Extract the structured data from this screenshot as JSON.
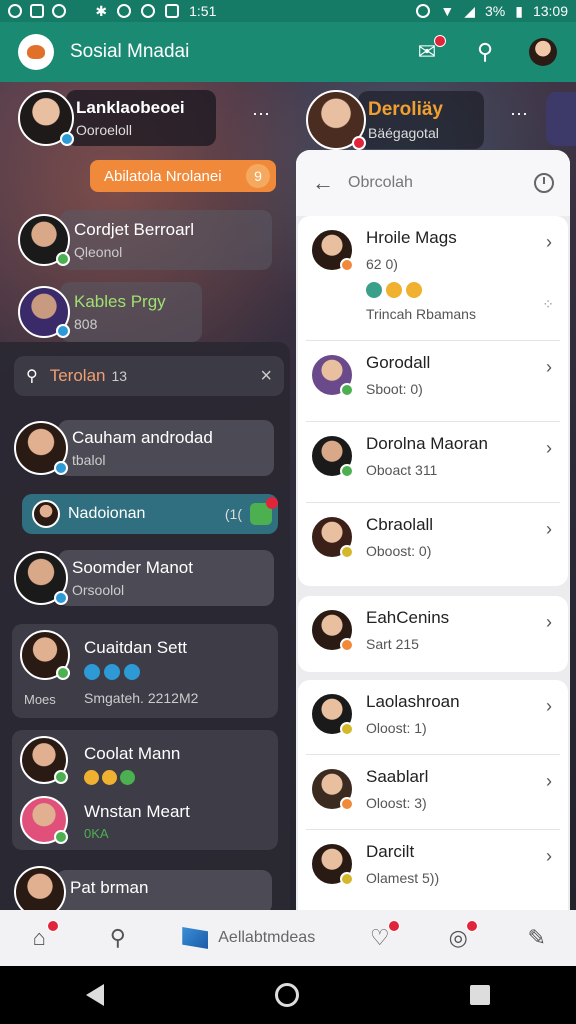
{
  "status_bar": {
    "battery": "3%",
    "time": "13:09",
    "left_text": "1:51"
  },
  "app_bar": {
    "title": "Sosial Mnadai"
  },
  "top_row": [
    {
      "name": "Lanklaobeoei",
      "sub": "Ooroeloll"
    },
    {
      "name": "Deroliäy",
      "sub": "Bäégagotal"
    }
  ],
  "orange_pill": {
    "label": "Abilatola Nrolanei",
    "icon_label": "9"
  },
  "left_cards": [
    {
      "name": "Cordjet Berroarl",
      "sub": "Qleonol"
    },
    {
      "name": "Kables Prgy",
      "sub": "808"
    }
  ],
  "search": {
    "query": "Terolan",
    "count": "13"
  },
  "list": [
    {
      "name": "Cauham androdad",
      "sub": "tbalol"
    },
    {
      "name": "Nadoionan",
      "count": "(1(",
      "active": true
    },
    {
      "name": "Soomder Manot",
      "sub": "Orsoolol"
    },
    {
      "name": "Cuaitdan Sett",
      "sub": "Smgateh. 2212M2",
      "extra": "Moes"
    },
    {
      "name": "Coolat Mann",
      "sub": ""
    },
    {
      "name": "Wnstan Meart",
      "sub": "0KA"
    },
    {
      "name": "Pat brman",
      "sub": ""
    }
  ],
  "panel": {
    "header_title": "Obrcolah",
    "items": [
      {
        "name": "Hroile Mags",
        "sub": "62 0)",
        "sub2": "Trincah Rbamans",
        "status_color": "#f08a3a"
      },
      {
        "name": "Gorodall",
        "sub": "Sboot: 0)",
        "status_color": "#4caf50"
      },
      {
        "name": "Dorolna Maoran",
        "sub": "Oboact 311",
        "status_color": "#4caf50"
      },
      {
        "name": "Cbraolall",
        "sub": "Oboost: 0)",
        "status_color": "#d4b82c"
      },
      {
        "name": "EahCenins",
        "sub": "Sart 215",
        "status_color": "#f08a3a"
      },
      {
        "name": "Laolashroan",
        "sub": "Oloost: 1)",
        "status_color": "#d4b82c"
      },
      {
        "name": "Saablarl",
        "sub": "Oloost: 3)",
        "status_color": "#f08a3a"
      },
      {
        "name": "Darcilt",
        "sub": "Olamest 5))",
        "status_color": "#d4b82c"
      }
    ]
  },
  "bottom_nav": {
    "center_label": "Aellabtmdeas"
  },
  "colors": {
    "accent": "#1a8a73",
    "orange": "#f08a3a",
    "badge": "#e0243a"
  }
}
